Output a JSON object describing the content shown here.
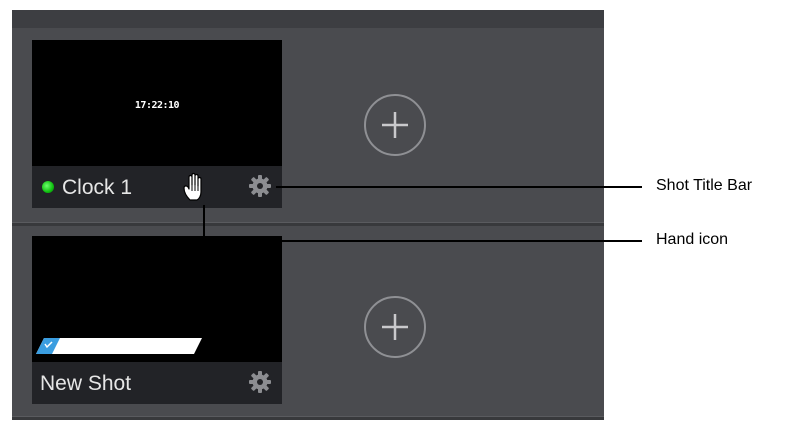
{
  "shots": [
    {
      "title": "Clock 1",
      "preview_text": "17:22:10",
      "tally_color": "#1ec81e",
      "icons": [
        "hand-icon",
        "gear-icon"
      ]
    },
    {
      "title": "New Shot",
      "icons": [
        "gear-icon"
      ],
      "progress_fill": 0.6
    }
  ],
  "add_buttons": [
    "plus-icon",
    "plus-icon"
  ],
  "callouts": {
    "title_bar": "Shot Title Bar",
    "hand_icon": "Hand icon"
  }
}
